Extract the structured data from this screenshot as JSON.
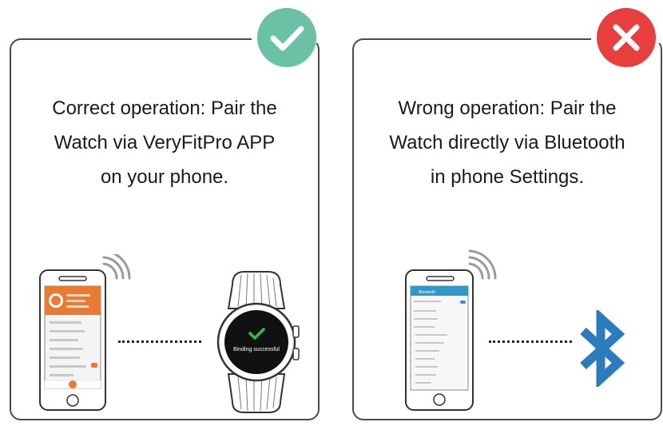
{
  "correct_panel": {
    "text_lines": [
      "Correct operation: Pair the",
      "Watch via VeryFitPro APP",
      "on your phone."
    ],
    "badge_icon": "check-icon",
    "badge_color": "#6ac1a5",
    "watch_status": "Binding successful"
  },
  "wrong_panel": {
    "text_lines": [
      "Wrong operation: Pair the",
      "Watch directly via Bluetooth",
      "in phone Settings."
    ],
    "badge_icon": "close-icon",
    "badge_color": "#e83e3d",
    "phone_screen_title": "Bluetooth",
    "bluetooth_symbol_color": "#2b7bbf"
  }
}
